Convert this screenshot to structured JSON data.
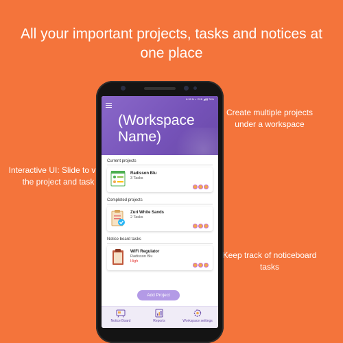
{
  "headline": "All your important projects, tasks and notices at one place",
  "notes": {
    "right_top": "Create multiple projects under a workspace",
    "left": "Interactive UI: Slide to view the project and task",
    "right_bottom": "Keep track of noticeboard tasks"
  },
  "app": {
    "status_bar": "8:30 N  ◐ ⊟ ≋ ◢ ▮ 76%",
    "workspace_name": "(Workspace Name)",
    "sections": {
      "current": "Current projects",
      "completed": "Completed projects",
      "notice": "Notice board tasks"
    },
    "cards": [
      {
        "title": "Radisson Blu",
        "subtitle": "3 Tasks",
        "extra": ""
      },
      {
        "title": "Zuri White Sands",
        "subtitle": "2 Tasks",
        "extra": ""
      },
      {
        "title": "WiFi Regulator",
        "subtitle": "Radisson Blu",
        "extra": "High"
      }
    ],
    "add_button": "Add Project",
    "nav": [
      {
        "label": "Notice Board",
        "icon": "notice-board-icon"
      },
      {
        "label": "Reports",
        "icon": "reports-icon"
      },
      {
        "label": "Workspace settings",
        "icon": "workspace-settings-icon"
      }
    ]
  },
  "colors": {
    "background": "#F4743B",
    "header_purple": "#7552B8",
    "button_purple": "#B39AE6",
    "priority_red": "#E53935"
  }
}
